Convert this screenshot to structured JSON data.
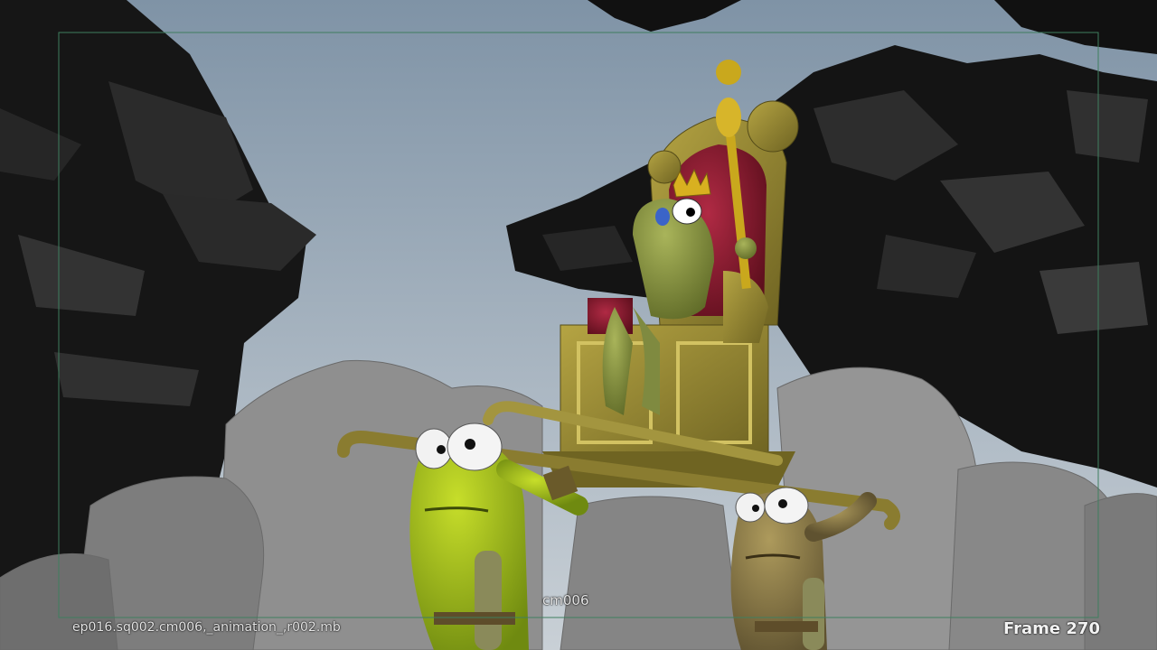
{
  "viewport": {
    "hud": {
      "camera_name": "cm006",
      "scene_file": "ep016.sq002.cm006,_animation_,r002.mb",
      "frame_text": "Frame 270"
    },
    "colors": {
      "sky_top": "#7f93a6",
      "sky_bottom": "#c9d0d6",
      "rock": "#8e8e8e",
      "foliage": "#1a1a1a",
      "safe_frame": "#3f7f5f",
      "throne_gold": "#8c7f2c",
      "throne_red": "#8a1c2e",
      "frog_king": "#8a9744",
      "frog_green": "#a7c321",
      "frog_olive": "#8e7e4a"
    }
  }
}
